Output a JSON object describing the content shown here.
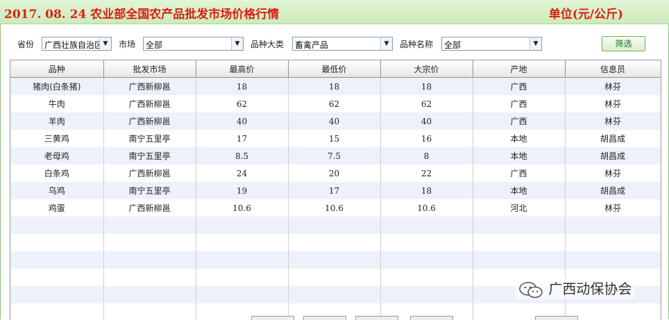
{
  "header": {
    "title": "2017. 08. 24  农业部全国农产品批发市场价格行情",
    "unit": "单位(元/公斤)"
  },
  "filters": {
    "province_label": "省份",
    "province_value": "广西壮族自治区",
    "market_label": "市场",
    "market_value": "全部",
    "category_label": "品种大类",
    "category_value": "畜禽产品",
    "variety_label": "品种名称",
    "variety_value": "全部",
    "filter_button": "筛选"
  },
  "table": {
    "columns": [
      "品种",
      "批发市场",
      "最高价",
      "最低价",
      "大宗价",
      "产地",
      "信息员"
    ],
    "rows": [
      [
        "猪肉(白条猪)",
        "广西新柳邕",
        "18",
        "18",
        "18",
        "广西",
        "林芬"
      ],
      [
        "牛肉",
        "广西新柳邕",
        "62",
        "62",
        "62",
        "广西",
        "林芬"
      ],
      [
        "羊肉",
        "广西新柳邕",
        "40",
        "40",
        "40",
        "广西",
        "林芬"
      ],
      [
        "三黄鸡",
        "南宁五里亭",
        "17",
        "15",
        "16",
        "本地",
        "胡昌成"
      ],
      [
        "老母鸡",
        "南宁五里亭",
        "8.5",
        "7.5",
        "8",
        "本地",
        "胡昌成"
      ],
      [
        "白条鸡",
        "广西新柳邕",
        "24",
        "20",
        "22",
        "广西",
        "林芬"
      ],
      [
        "乌鸡",
        "南宁五里亭",
        "19",
        "17",
        "18",
        "本地",
        "胡昌成"
      ],
      [
        "鸡蛋",
        "广西新柳邕",
        "10.6",
        "10.6",
        "10.6",
        "河北",
        "林芬"
      ]
    ]
  },
  "watermark": {
    "icon": "wechat-icon",
    "text": "广西动保协会"
  },
  "colors": {
    "title_red": "#d81f12",
    "header_green": "#cdebbb",
    "row_alt": "#edf1fa"
  }
}
